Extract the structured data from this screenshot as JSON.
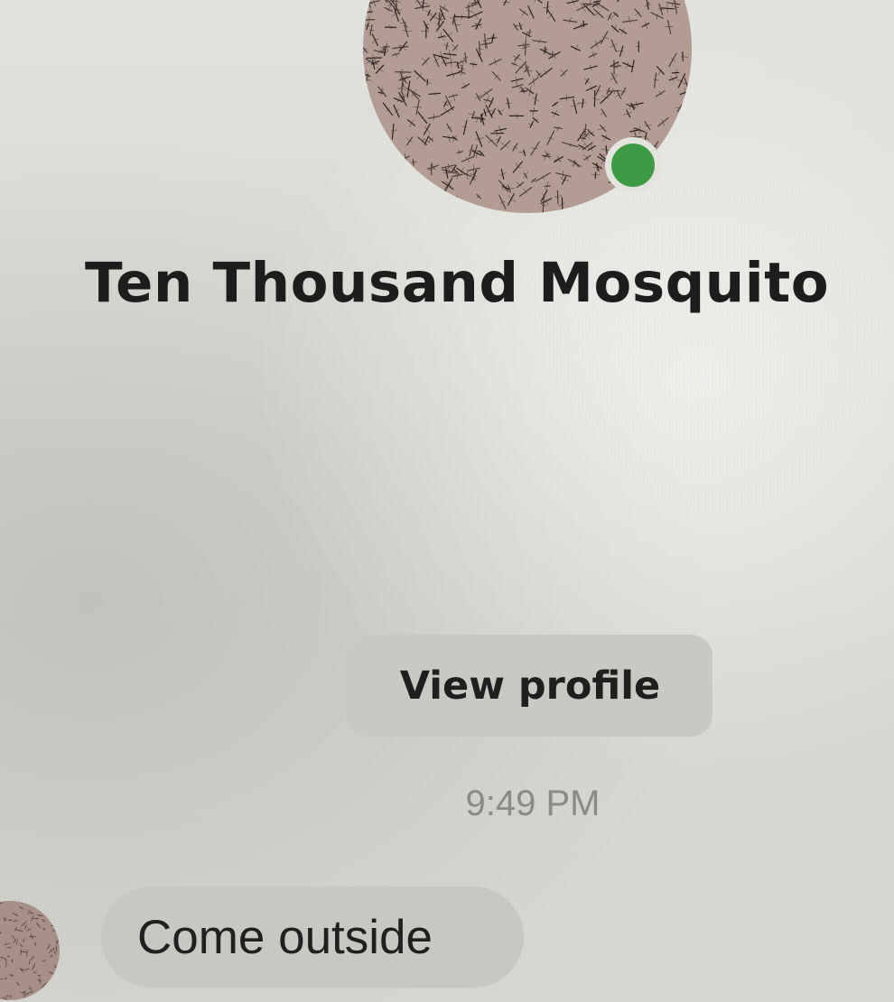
{
  "contact": {
    "name": "Ten Thousand Mosquito",
    "avatar_icon": "mosquito-swarm-avatar",
    "online_status_icon": "online-dot-icon",
    "online_color": "#3e9b45"
  },
  "actions": {
    "view_profile_label": "View profile"
  },
  "conversation": {
    "timestamp": "9:49 PM",
    "messages": [
      {
        "sender": "contact",
        "text": "Come outside"
      }
    ]
  },
  "colors": {
    "background": "#dcdcd6",
    "bubble": "#c8c8c2",
    "button": "#c9c9c3",
    "text": "#1d1d1d",
    "timestamp": "#8a8a86"
  }
}
